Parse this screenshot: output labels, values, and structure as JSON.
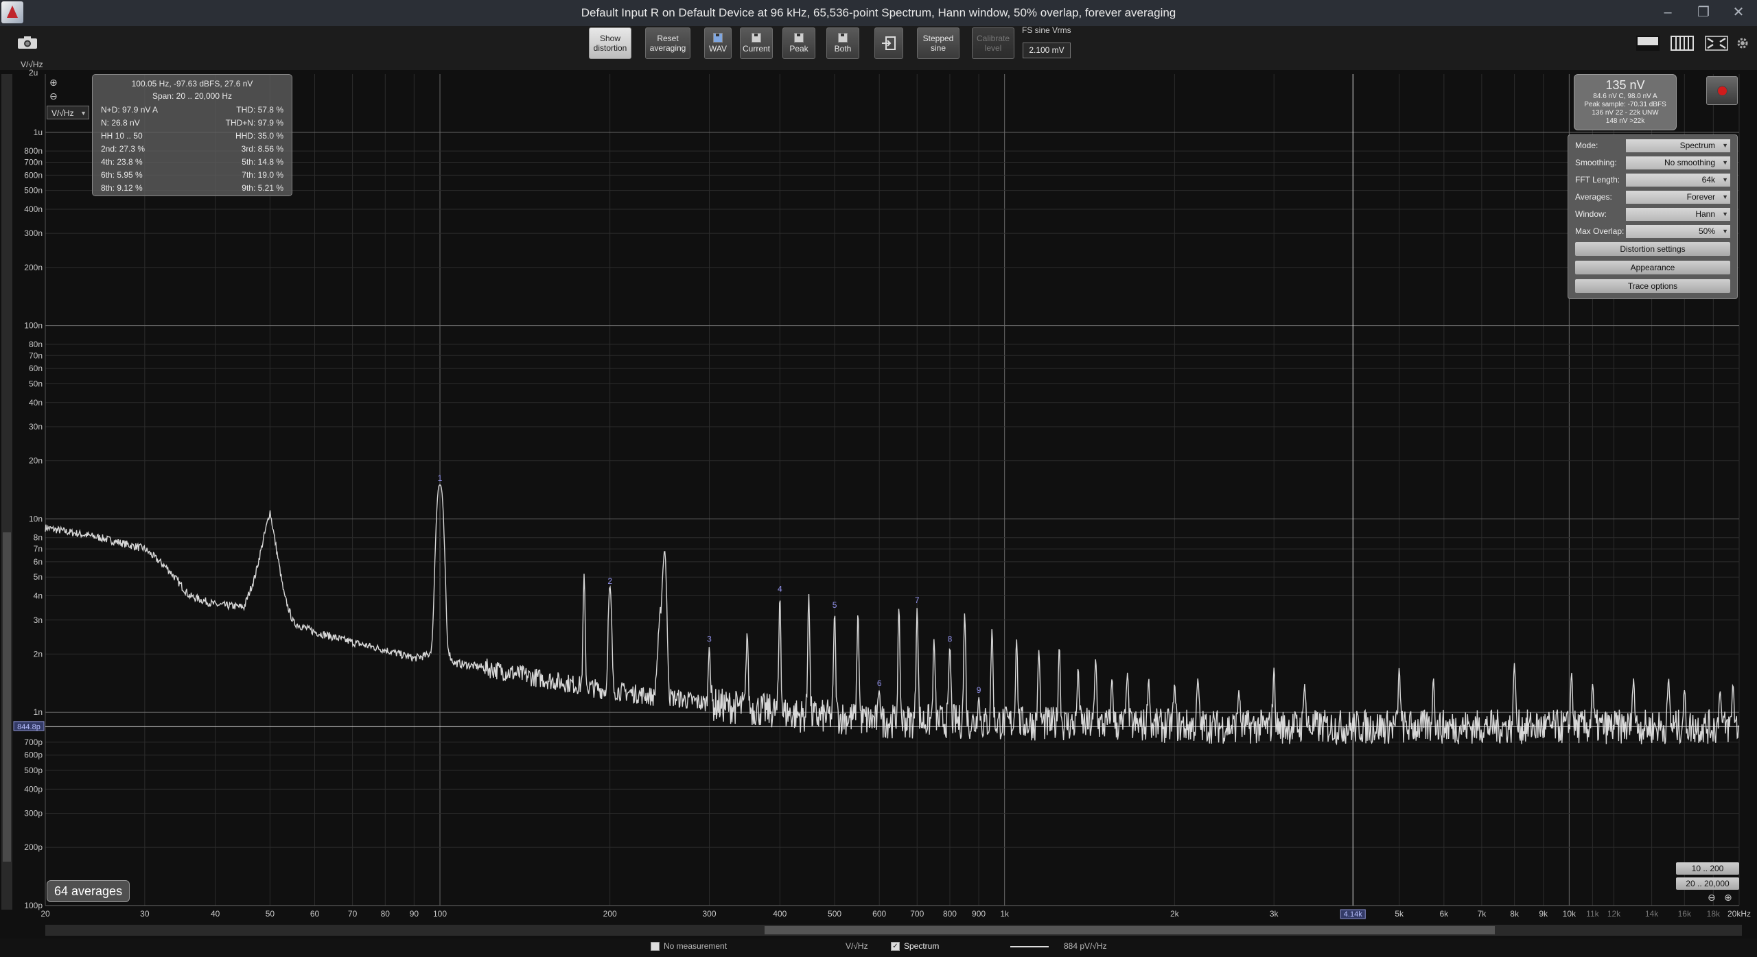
{
  "window": {
    "title": "Default Input R on Default Device at 96 kHz, 65,536-point Spectrum, Hann window, 50% overlap, forever averaging",
    "minimize": "–",
    "maximize": "❐",
    "close": "✕"
  },
  "toolbar": {
    "show_distortion": [
      "Show",
      "distortion"
    ],
    "reset_averaging": [
      "Reset",
      "averaging"
    ],
    "wav": "WAV",
    "current": "Current",
    "peak": "Peak",
    "both": "Both",
    "stepped_sine": [
      "Stepped",
      "sine"
    ],
    "calibrate_level": [
      "Calibrate",
      "level"
    ],
    "fs_label": "FS sine Vrms",
    "fs_value": "2.100 mV"
  },
  "y_axis": {
    "unit_label": "V/√Hz",
    "unit_select": "V/√Hz",
    "top_label": "2u",
    "ticks": [
      {
        "v": 1e-06,
        "l": "1u",
        "major": true
      },
      {
        "v": 8e-07,
        "l": "800n"
      },
      {
        "v": 7e-07,
        "l": "700n"
      },
      {
        "v": 6e-07,
        "l": "600n"
      },
      {
        "v": 5e-07,
        "l": "500n"
      },
      {
        "v": 4e-07,
        "l": "400n"
      },
      {
        "v": 3e-07,
        "l": "300n"
      },
      {
        "v": 2e-07,
        "l": "200n"
      },
      {
        "v": 1e-07,
        "l": "100n",
        "major": true
      },
      {
        "v": 8e-08,
        "l": "80n"
      },
      {
        "v": 7e-08,
        "l": "70n"
      },
      {
        "v": 6e-08,
        "l": "60n"
      },
      {
        "v": 5e-08,
        "l": "50n"
      },
      {
        "v": 4e-08,
        "l": "40n"
      },
      {
        "v": 3e-08,
        "l": "30n"
      },
      {
        "v": 2e-08,
        "l": "20n"
      },
      {
        "v": 1e-08,
        "l": "10n",
        "major": true
      },
      {
        "v": 8e-09,
        "l": "8n"
      },
      {
        "v": 7e-09,
        "l": "7n"
      },
      {
        "v": 6e-09,
        "l": "6n"
      },
      {
        "v": 5e-09,
        "l": "5n"
      },
      {
        "v": 4e-09,
        "l": "4n"
      },
      {
        "v": 3e-09,
        "l": "3n"
      },
      {
        "v": 2e-09,
        "l": "2n"
      },
      {
        "v": 1e-09,
        "l": "1n",
        "major": true
      },
      {
        "v": 7e-10,
        "l": "700p"
      },
      {
        "v": 6e-10,
        "l": "600p"
      },
      {
        "v": 5e-10,
        "l": "500p"
      },
      {
        "v": 4e-10,
        "l": "400p"
      },
      {
        "v": 3e-10,
        "l": "300p"
      },
      {
        "v": 2e-10,
        "l": "200p"
      },
      {
        "v": 1e-10,
        "l": "100p",
        "major": true
      }
    ],
    "cursor_label": "844.8p",
    "cursor_value": 8.448e-10
  },
  "x_axis": {
    "ticks": [
      {
        "v": 20,
        "l": "20"
      },
      {
        "v": 30,
        "l": "30"
      },
      {
        "v": 40,
        "l": "40"
      },
      {
        "v": 50,
        "l": "50"
      },
      {
        "v": 60,
        "l": "60"
      },
      {
        "v": 70,
        "l": "70"
      },
      {
        "v": 80,
        "l": "80"
      },
      {
        "v": 90,
        "l": "90"
      },
      {
        "v": 100,
        "l": "100",
        "major": true
      },
      {
        "v": 200,
        "l": "200"
      },
      {
        "v": 300,
        "l": "300"
      },
      {
        "v": 400,
        "l": "400"
      },
      {
        "v": 500,
        "l": "500"
      },
      {
        "v": 600,
        "l": "600"
      },
      {
        "v": 700,
        "l": "700"
      },
      {
        "v": 800,
        "l": "800"
      },
      {
        "v": 900,
        "l": "900"
      },
      {
        "v": 1000,
        "l": "1k",
        "major": true
      },
      {
        "v": 2000,
        "l": "2k"
      },
      {
        "v": 3000,
        "l": "3k"
      },
      {
        "v": 5000,
        "l": "5k"
      },
      {
        "v": 6000,
        "l": "6k"
      },
      {
        "v": 7000,
        "l": "7k"
      },
      {
        "v": 8000,
        "l": "8k"
      },
      {
        "v": 9000,
        "l": "9k"
      },
      {
        "v": 10000,
        "l": "10k",
        "major": true
      },
      {
        "v": 11000,
        "l": "11k",
        "dim": true
      },
      {
        "v": 12000,
        "l": "12k",
        "dim": true
      },
      {
        "v": 14000,
        "l": "14k",
        "dim": true
      },
      {
        "v": 16000,
        "l": "16k",
        "dim": true
      },
      {
        "v": 18000,
        "l": "18k",
        "dim": true
      },
      {
        "v": 20000,
        "l": "20kHz"
      }
    ],
    "cursor_label": "4.14k",
    "cursor_value": 4140
  },
  "info": {
    "line1": "100.05 Hz, -97.63 dBFS, 27.6 nV",
    "span": "Span: 20 .. 20,000 Hz",
    "rows": [
      [
        "N+D: 97.9 nV A",
        "THD: 57.8 %"
      ],
      [
        "N: 26.8 nV",
        "THD+N: 97.9 %"
      ],
      [
        "HH 10 .. 50",
        "HHD: 35.0 %"
      ],
      [
        "2nd: 27.3 %",
        "3rd: 8.56 %"
      ],
      [
        "4th: 23.8 %",
        "5th: 14.8 %"
      ],
      [
        "6th: 5.95 %",
        "7th: 19.0 %"
      ],
      [
        "8th: 9.12 %",
        "9th: 5.21 %"
      ]
    ]
  },
  "level": {
    "main": "135 nV",
    "l1": "84.6 nV C, 98.0 nV A",
    "l2": "Peak sample: -70.31 dBFS",
    "l3": "136 nV 22 - 22k UNW",
    "l4": "148 nV >22k"
  },
  "settings": {
    "mode": {
      "label": "Mode:",
      "value": "Spectrum"
    },
    "smoothing": {
      "label": "Smoothing:",
      "value": "No smoothing"
    },
    "fft": {
      "label": "FFT Length:",
      "value": "64k"
    },
    "averages": {
      "label": "Averages:",
      "value": "Forever"
    },
    "window": {
      "label": "Window:",
      "value": "Hann"
    },
    "overlap": {
      "label": "Max Overlap:",
      "value": "50%"
    },
    "distortion_btn": "Distortion settings",
    "appearance_btn": "Appearance",
    "trace_btn": "Trace options"
  },
  "averages_badge": "64 averages",
  "range_buttons": [
    "10 .. 200",
    "20 .. 20,000"
  ],
  "status": {
    "no_measurement": "No measurement",
    "unit": "V/√Hz",
    "spectrum": "Spectrum",
    "trace_value": "884 pV/√Hz"
  },
  "chart_data": {
    "type": "line",
    "x_scale": "log",
    "y_scale": "log",
    "xlim": [
      20,
      20000
    ],
    "ylim": [
      1e-10,
      2e-06
    ],
    "series": [
      {
        "name": "Spectrum",
        "color": "#d8d8d8",
        "x": [
          20,
          25,
          30,
          33,
          36,
          40,
          45,
          47,
          50,
          53,
          55,
          60,
          70,
          80,
          90,
          97,
          100,
          103,
          106,
          120,
          150,
          197,
          200,
          203,
          240,
          250,
          255,
          300,
          350,
          400,
          450,
          500,
          600,
          700,
          800,
          900,
          1000,
          1500,
          2000,
          3000,
          4000,
          6000,
          10000,
          20000
        ],
        "y": [
          9e-09,
          8e-09,
          7e-09,
          5.5e-09,
          4e-09,
          3.6e-09,
          3.5e-09,
          5e-09,
          1.1e-08,
          4e-09,
          2.9e-09,
          2.6e-09,
          2.3e-09,
          2.1e-09,
          1.9e-09,
          2e-09,
          1.5e-08,
          2e-09,
          1.8e-09,
          1.7e-09,
          1.5e-09,
          1.3e-09,
          4.4e-09,
          1.3e-09,
          1.2e-09,
          6.8e-09,
          1.2e-09,
          1.1e-09,
          1.05e-09,
          1e-09,
          9.5e-10,
          9.5e-10,
          9e-10,
          9e-10,
          9e-10,
          8.8e-10,
          8.8e-10,
          8.6e-10,
          8.5e-10,
          8.4e-10,
          8.4e-10,
          8.4e-10,
          8.4e-10,
          8.4e-10
        ]
      }
    ],
    "harmonics": [
      {
        "n": "1",
        "f": 100,
        "v": 1.5e-08
      },
      {
        "n": "2",
        "f": 200,
        "v": 4.4e-09
      },
      {
        "n": "3",
        "f": 300,
        "v": 2.2e-09
      },
      {
        "n": "4",
        "f": 400,
        "v": 4e-09
      },
      {
        "n": "5",
        "f": 500,
        "v": 3.3e-09
      },
      {
        "n": "6",
        "f": 600,
        "v": 1.3e-09
      },
      {
        "n": "7",
        "f": 700,
        "v": 3.5e-09
      },
      {
        "n": "8",
        "f": 800,
        "v": 2.2e-09
      },
      {
        "n": "9",
        "f": 900,
        "v": 1.2e-09
      }
    ],
    "spurs": [
      {
        "f": 180,
        "v": 5.2e-09
      },
      {
        "f": 250,
        "v": 6.8e-09
      },
      {
        "f": 350,
        "v": 2.6e-09
      },
      {
        "f": 450,
        "v": 4.1e-09
      },
      {
        "f": 550,
        "v": 3.3e-09
      },
      {
        "f": 650,
        "v": 3.5e-09
      },
      {
        "f": 750,
        "v": 2.4e-09
      },
      {
        "f": 850,
        "v": 3.3e-09
      },
      {
        "f": 950,
        "v": 2.7e-09
      },
      {
        "f": 1050,
        "v": 2.4e-09
      },
      {
        "f": 1150,
        "v": 2.1e-09
      },
      {
        "f": 1250,
        "v": 2.2e-09
      },
      {
        "f": 1350,
        "v": 1.7e-09
      },
      {
        "f": 1450,
        "v": 1.9e-09
      },
      {
        "f": 1550,
        "v": 1.5e-09
      },
      {
        "f": 1650,
        "v": 1.6e-09
      },
      {
        "f": 1800,
        "v": 1.5e-09
      },
      {
        "f": 2000,
        "v": 1.4e-09
      },
      {
        "f": 2200,
        "v": 1.5e-09
      },
      {
        "f": 2600,
        "v": 1.3e-09
      },
      {
        "f": 3000,
        "v": 1.7e-09
      },
      {
        "f": 3400,
        "v": 1.4e-09
      },
      {
        "f": 5000,
        "v": 1.7e-09
      },
      {
        "f": 5750,
        "v": 1.5e-09
      },
      {
        "f": 8000,
        "v": 1.8e-09
      },
      {
        "f": 10100,
        "v": 1.6e-09
      },
      {
        "f": 11000,
        "v": 1.4e-09
      },
      {
        "f": 13000,
        "v": 1.5e-09
      },
      {
        "f": 15000,
        "v": 1.5e-09
      },
      {
        "f": 16000,
        "v": 1.3e-09
      },
      {
        "f": 18500,
        "v": 1.3e-09
      },
      {
        "f": 19500,
        "v": 1.4e-09
      }
    ],
    "grid": true
  }
}
